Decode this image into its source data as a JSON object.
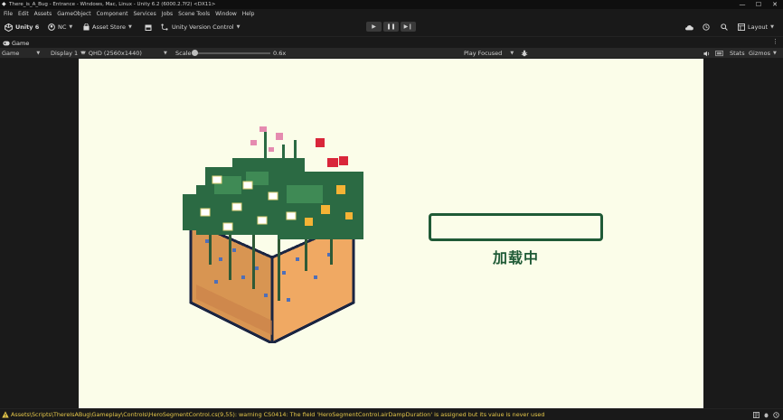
{
  "window": {
    "title": "There_is_A_Bug - Entrance - Windows, Mac, Linux - Unity 6.2 (6000.2.7f2) <DX11>",
    "controls": [
      "—",
      "☐",
      "✕"
    ]
  },
  "menu": [
    "File",
    "Edit",
    "Assets",
    "GameObject",
    "Component",
    "Services",
    "Jobs",
    "Scene Tools",
    "Window",
    "Help"
  ],
  "toolbar": {
    "unity_label": "Unity 6",
    "account_label": "NC",
    "asset_store_label": "Asset Store",
    "version_control_label": "Unity Version Control",
    "layout_label": "Layout"
  },
  "tab": {
    "label": "Game"
  },
  "gamebar": {
    "view_mode": "Game",
    "display": "Display 1",
    "resolution": "QHD (2560x1440)",
    "scale_label": "Scale",
    "scale_value": "0.6x",
    "scale_fraction": 0.0,
    "play_focus": "Play Focused",
    "stats_label": "Stats",
    "gizmos_label": "Gizmos"
  },
  "game": {
    "loading_text": "加载中",
    "loading_progress": 0.0,
    "colors": {
      "bg": "#fbfde9",
      "bar": "#1f5a36"
    }
  },
  "status": {
    "message": "Assets\\Scripts\\ThereIsABug\\Gameplay\\Controls\\HeroSegmentControl.cs(9,55): warning CS0414: The field 'HeroSegmentControl.airDampDuration' is assigned but its value is never used",
    "accent": "#e6c84a"
  }
}
